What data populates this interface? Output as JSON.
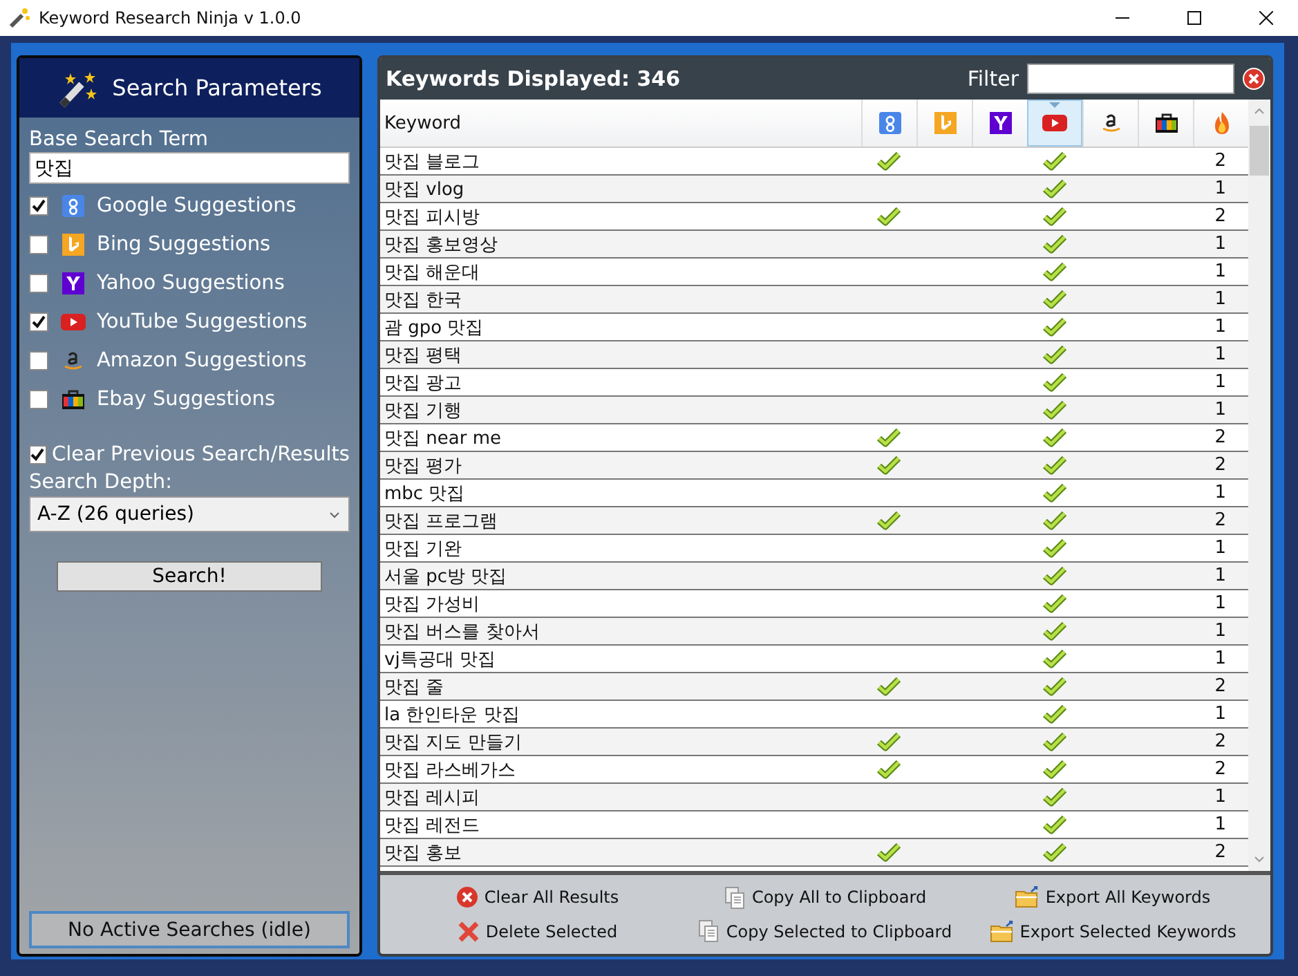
{
  "window": {
    "title": "Keyword Research Ninja v 1.0.0"
  },
  "search_panel": {
    "title": "Search Parameters",
    "base_term_label": "Base Search Term",
    "base_term": "맛집",
    "sources": [
      {
        "kind": "google",
        "label": "Google Suggestions",
        "checked": true
      },
      {
        "kind": "bing",
        "label": "Bing Suggestions",
        "checked": false
      },
      {
        "kind": "yahoo",
        "label": "Yahoo Suggestions",
        "checked": false
      },
      {
        "kind": "youtube",
        "label": "YouTube Suggestions",
        "checked": true
      },
      {
        "kind": "amazon",
        "label": "Amazon Suggestions",
        "checked": false
      },
      {
        "kind": "ebay",
        "label": "Ebay Suggestions",
        "checked": false
      }
    ],
    "clear_previous": {
      "label": "Clear Previous Search/Results",
      "checked": true
    },
    "depth_label": "Search Depth:",
    "depth": "A-Z (26 queries)",
    "search_button": "Search!",
    "status": "No Active Searches (idle)"
  },
  "results": {
    "title": "Keywords Displayed: 346",
    "filter_label": "Filter",
    "keyword_column": "Keyword",
    "columns": [
      {
        "kind": "google",
        "selected": false
      },
      {
        "kind": "bing",
        "selected": false
      },
      {
        "kind": "yahoo",
        "selected": false
      },
      {
        "kind": "youtube",
        "selected": true
      },
      {
        "kind": "amazon",
        "selected": false
      },
      {
        "kind": "ebay",
        "selected": false
      },
      {
        "kind": "count",
        "selected": false
      }
    ],
    "rows": [
      {
        "keyword": "맛집 블로그",
        "found": [
          true,
          false,
          false,
          true,
          false,
          false
        ],
        "count": "2"
      },
      {
        "keyword": "맛집 vlog",
        "found": [
          false,
          false,
          false,
          true,
          false,
          false
        ],
        "count": "1"
      },
      {
        "keyword": "맛집 피시방",
        "found": [
          true,
          false,
          false,
          true,
          false,
          false
        ],
        "count": "2"
      },
      {
        "keyword": "맛집 홍보영상",
        "found": [
          false,
          false,
          false,
          true,
          false,
          false
        ],
        "count": "1"
      },
      {
        "keyword": "맛집 해운대",
        "found": [
          false,
          false,
          false,
          true,
          false,
          false
        ],
        "count": "1"
      },
      {
        "keyword": "맛집 한국",
        "found": [
          false,
          false,
          false,
          true,
          false,
          false
        ],
        "count": "1"
      },
      {
        "keyword": "괌 gpo 맛집",
        "found": [
          false,
          false,
          false,
          true,
          false,
          false
        ],
        "count": "1"
      },
      {
        "keyword": "맛집 평택",
        "found": [
          false,
          false,
          false,
          true,
          false,
          false
        ],
        "count": "1"
      },
      {
        "keyword": "맛집 광고",
        "found": [
          false,
          false,
          false,
          true,
          false,
          false
        ],
        "count": "1"
      },
      {
        "keyword": "맛집 기행",
        "found": [
          false,
          false,
          false,
          true,
          false,
          false
        ],
        "count": "1"
      },
      {
        "keyword": "맛집 near me",
        "found": [
          true,
          false,
          false,
          true,
          false,
          false
        ],
        "count": "2"
      },
      {
        "keyword": "맛집 평가",
        "found": [
          true,
          false,
          false,
          true,
          false,
          false
        ],
        "count": "2"
      },
      {
        "keyword": "mbc 맛집",
        "found": [
          false,
          false,
          false,
          true,
          false,
          false
        ],
        "count": "1"
      },
      {
        "keyword": "맛집 프로그램",
        "found": [
          true,
          false,
          false,
          true,
          false,
          false
        ],
        "count": "2"
      },
      {
        "keyword": "맛집 기완",
        "found": [
          false,
          false,
          false,
          true,
          false,
          false
        ],
        "count": "1"
      },
      {
        "keyword": "서울 pc방 맛집",
        "found": [
          false,
          false,
          false,
          true,
          false,
          false
        ],
        "count": "1"
      },
      {
        "keyword": "맛집 가성비",
        "found": [
          false,
          false,
          false,
          true,
          false,
          false
        ],
        "count": "1"
      },
      {
        "keyword": "맛집 버스를 찾아서",
        "found": [
          false,
          false,
          false,
          true,
          false,
          false
        ],
        "count": "1"
      },
      {
        "keyword": "vj특공대 맛집",
        "found": [
          false,
          false,
          false,
          true,
          false,
          false
        ],
        "count": "1"
      },
      {
        "keyword": "맛집 줄",
        "found": [
          true,
          false,
          false,
          true,
          false,
          false
        ],
        "count": "2"
      },
      {
        "keyword": "la 한인타운 맛집",
        "found": [
          false,
          false,
          false,
          true,
          false,
          false
        ],
        "count": "1"
      },
      {
        "keyword": "맛집 지도 만들기",
        "found": [
          true,
          false,
          false,
          true,
          false,
          false
        ],
        "count": "2"
      },
      {
        "keyword": "맛집 라스베가스",
        "found": [
          true,
          false,
          false,
          true,
          false,
          false
        ],
        "count": "2"
      },
      {
        "keyword": "맛집 레시피",
        "found": [
          false,
          false,
          false,
          true,
          false,
          false
        ],
        "count": "1"
      },
      {
        "keyword": "맛집 레전드",
        "found": [
          false,
          false,
          false,
          true,
          false,
          false
        ],
        "count": "1"
      },
      {
        "keyword": "맛집 홍보",
        "found": [
          true,
          false,
          false,
          true,
          false,
          false
        ],
        "count": "2"
      }
    ],
    "actions": [
      {
        "kind": "clear",
        "label": "Clear All Results"
      },
      {
        "kind": "copy",
        "label": "Copy All to Clipboard"
      },
      {
        "kind": "export",
        "label": "Export All Keywords"
      },
      {
        "kind": "delete",
        "label": "Delete Selected"
      },
      {
        "kind": "copy",
        "label": "Copy Selected to Clipboard"
      },
      {
        "kind": "export",
        "label": "Export Selected Keywords"
      }
    ]
  }
}
